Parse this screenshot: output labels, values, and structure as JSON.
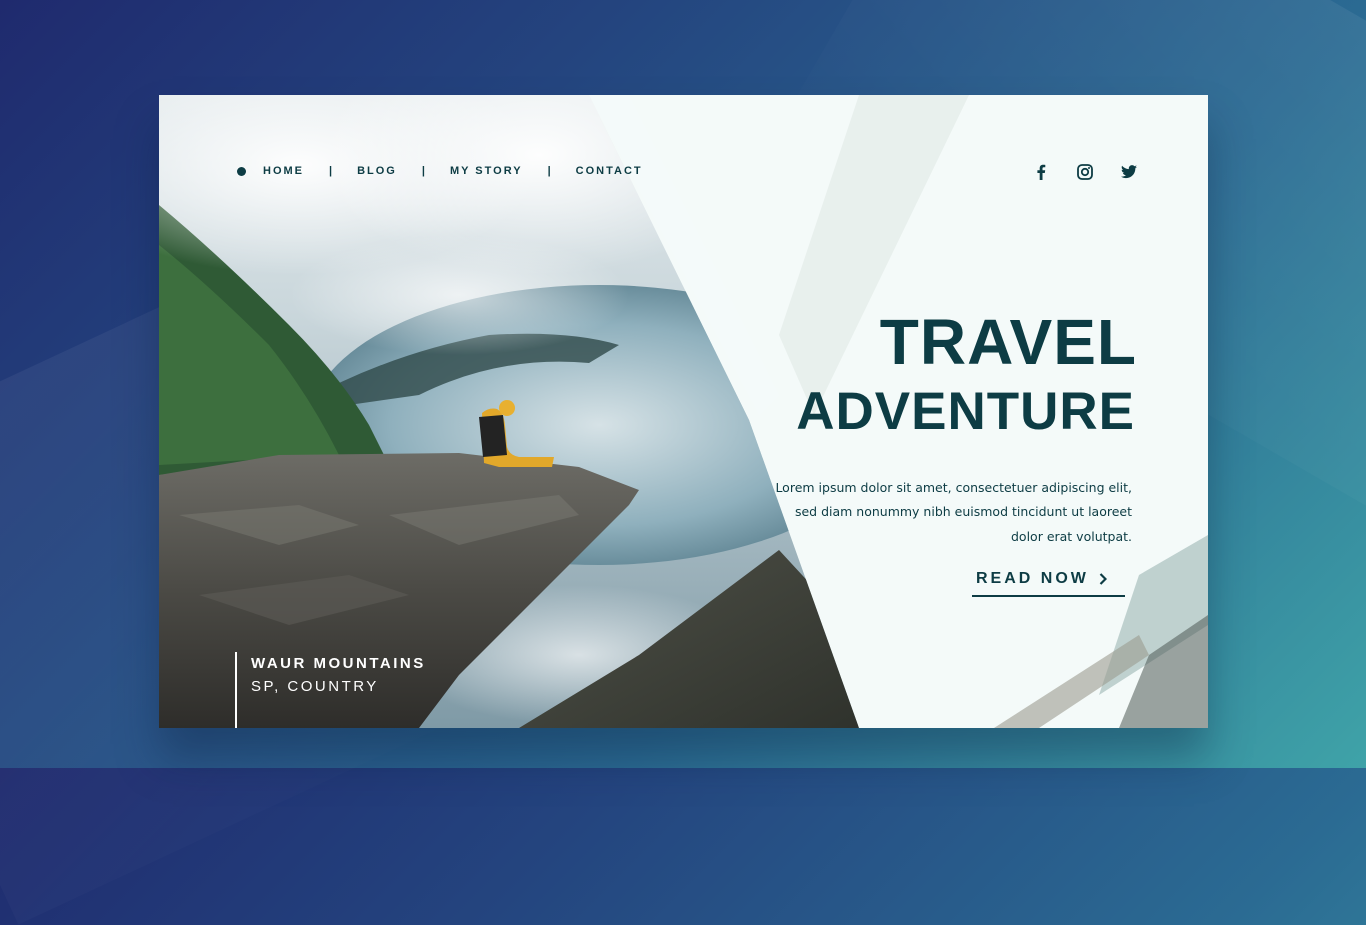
{
  "nav": {
    "items": [
      {
        "label": "HOME"
      },
      {
        "label": "BLOG"
      },
      {
        "label": "MY STORY"
      },
      {
        "label": "CONTACT"
      }
    ],
    "separator": "|"
  },
  "social": {
    "icons": [
      "facebook-icon",
      "instagram-icon",
      "twitter-icon"
    ]
  },
  "hero": {
    "title_line1": "TRAVEL",
    "title_line2": "ADVENTURE",
    "description": "Lorem ipsum dolor sit amet, consectetuer adipiscing elit, sed diam nonummy nibh euismod tincidunt ut laoreet dolor erat volutpat.",
    "cta_label": "READ NOW",
    "cta_icon": "chevron-right-icon"
  },
  "location": {
    "name": "WAUR MOUNTAINS",
    "country": "SP, COUNTRY"
  },
  "colors": {
    "primary": "#0d3c44",
    "panel": "#f4faf9",
    "text_on_photo": "#ffffff"
  }
}
